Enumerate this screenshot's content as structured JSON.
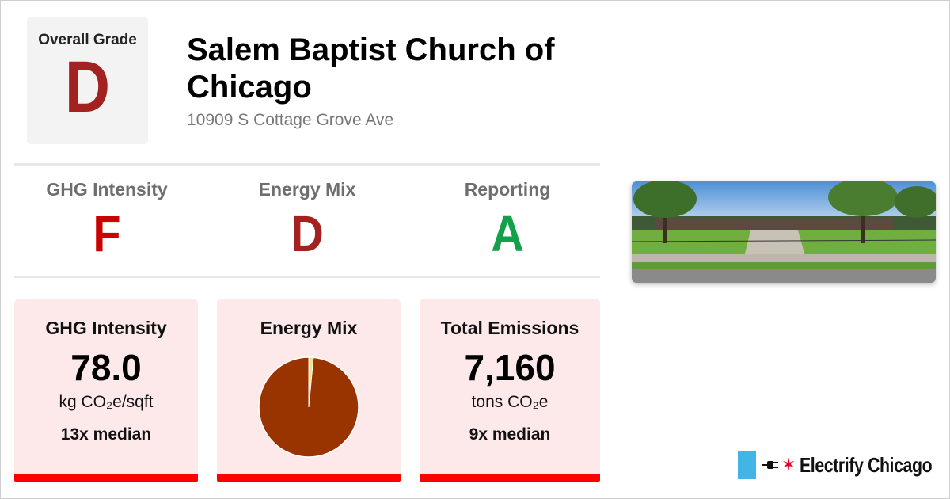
{
  "overall": {
    "label": "Overall Grade",
    "grade": "D"
  },
  "building": {
    "name": "Salem Baptist Church of Chicago",
    "address": "10909 S Cottage Grove Ave"
  },
  "grades": [
    {
      "label": "GHG Intensity",
      "value": "F",
      "color": "#cc0000"
    },
    {
      "label": "Energy Mix",
      "value": "D",
      "color": "#a32121"
    },
    {
      "label": "Reporting",
      "value": "A",
      "color": "#12a14a"
    }
  ],
  "cards": {
    "ghg": {
      "title": "GHG Intensity",
      "value": "78.0",
      "unit": "kg CO₂e/sqft",
      "median": "13x median"
    },
    "mix": {
      "title": "Energy Mix",
      "gas_fraction": 0.985,
      "electric_fraction": 0.015,
      "gas_color": "#993300",
      "electric_color": "#f5e08a"
    },
    "emissions": {
      "title": "Total Emissions",
      "value": "7,160",
      "unit": "tons CO₂e",
      "median": "9x median"
    }
  },
  "photo": {
    "icon": "building-street-photo"
  },
  "brand": {
    "name": "Electrify Chicago",
    "flag_color": "#41b6e6",
    "star_color": "#e4002b",
    "icons": [
      "chicago-flag-icon",
      "plug-icon",
      "star-icon"
    ]
  }
}
